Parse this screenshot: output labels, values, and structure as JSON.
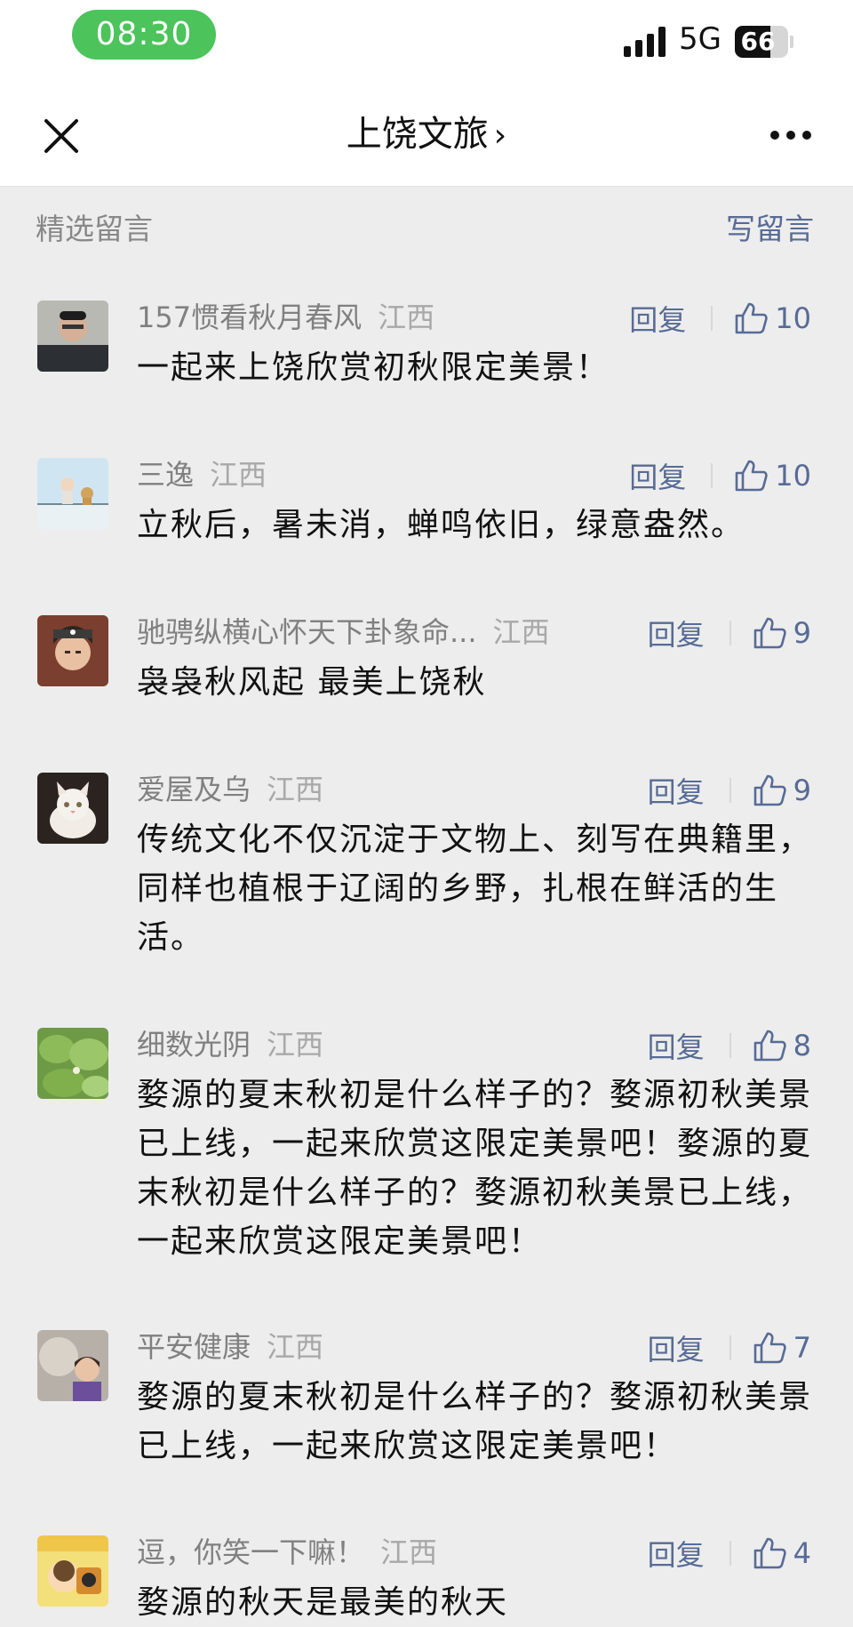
{
  "status_bar": {
    "time": "08:30",
    "network": "5G",
    "battery": "66",
    "battery_level": 0.66
  },
  "nav": {
    "title": "上饶文旅",
    "chevron": "›",
    "close_icon": "close-icon",
    "more_icon": "more-icon"
  },
  "section": {
    "title": "精选留言",
    "write": "写留言"
  },
  "reply_label": "回复",
  "comments": [
    {
      "nickname": "157惯看秋月春风",
      "region": "江西",
      "likes": "10",
      "content": "一起来上饶欣赏初秋限定美景！"
    },
    {
      "nickname": "三逸",
      "region": "江西",
      "likes": "10",
      "content": "立秋后，暑未消，蝉鸣依旧，绿意盎然。"
    },
    {
      "nickname": "驰骋纵横心怀天下卦象命...",
      "region": "江西",
      "likes": "9",
      "content": "袅袅秋风起 最美上饶秋"
    },
    {
      "nickname": "爱屋及乌",
      "region": "江西",
      "likes": "9",
      "content": "传统文化不仅沉淀于文物上、刻写在典籍里，同样也植根于辽阔的乡野，扎根在鲜活的生活。"
    },
    {
      "nickname": "细数光阴",
      "region": "江西",
      "likes": "8",
      "content": "婺源的夏末秋初是什么样子的？婺源初秋美景已上线，一起来欣赏这限定美景吧！婺源的夏末秋初是什么样子的？婺源初秋美景已上线，一起来欣赏这限定美景吧！"
    },
    {
      "nickname": "平安健康",
      "region": "江西",
      "likes": "7",
      "content": "婺源的夏末秋初是什么样子的？婺源初秋美景已上线，一起来欣赏这限定美景吧！"
    },
    {
      "nickname": "逗，你笑一下嘛！",
      "region": "江西",
      "likes": "4",
      "content": "婺源的秋天是最美的秋天"
    }
  ]
}
